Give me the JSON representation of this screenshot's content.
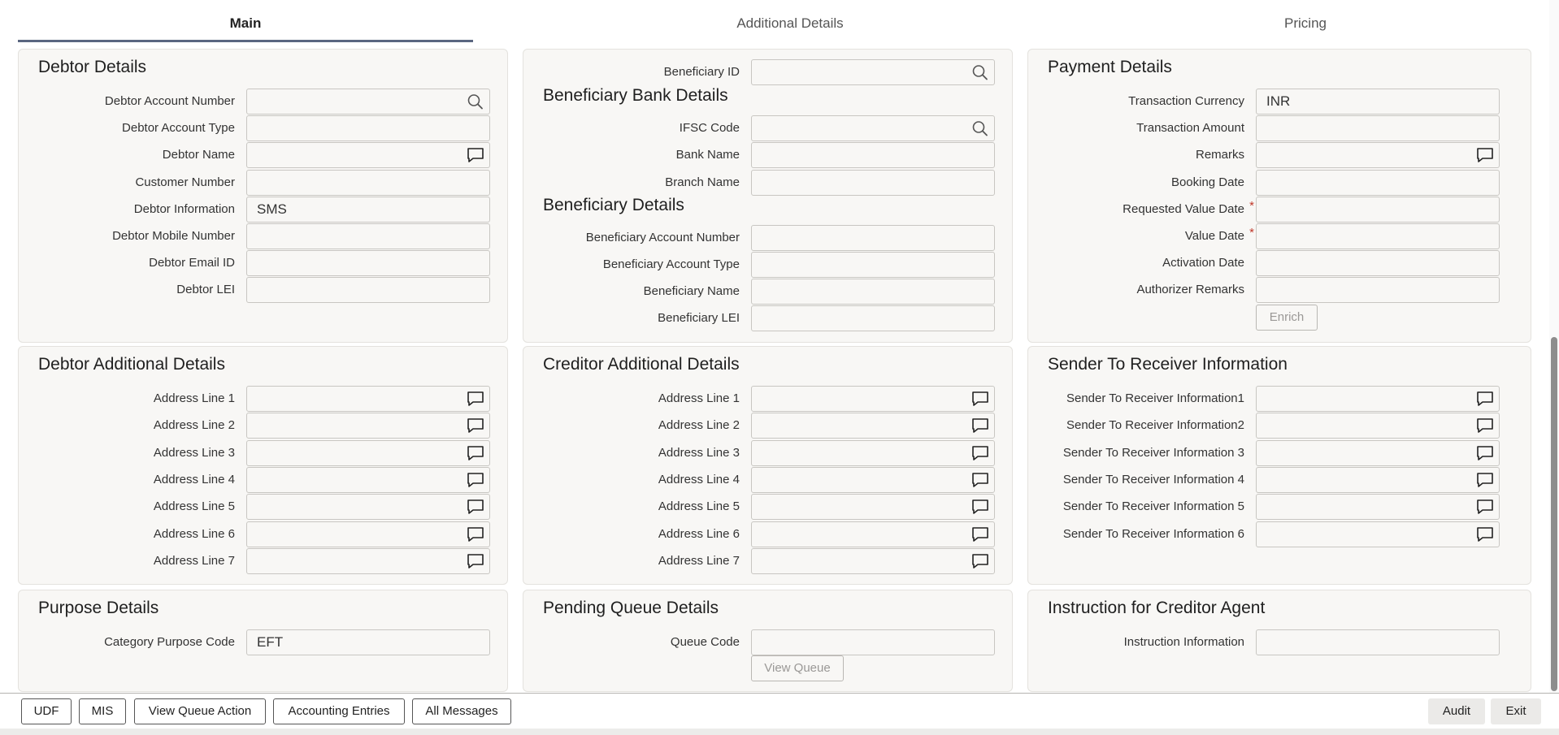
{
  "tabs": [
    {
      "label": "Main",
      "active": true
    },
    {
      "label": "Additional Details",
      "active": false
    },
    {
      "label": "Pricing",
      "active": false
    }
  ],
  "debtor_details": {
    "title": "Debtor Details",
    "fields": [
      {
        "label": "Debtor Account Number",
        "value": "",
        "icon": "search-icon"
      },
      {
        "label": "Debtor Account Type",
        "value": ""
      },
      {
        "label": "Debtor Name",
        "value": "",
        "icon": "comment-icon"
      },
      {
        "label": "Customer Number",
        "value": ""
      },
      {
        "label": "Debtor Information",
        "value": "SMS"
      },
      {
        "label": "Debtor Mobile Number",
        "value": ""
      },
      {
        "label": "Debtor Email ID",
        "value": ""
      },
      {
        "label": "Debtor LEI",
        "value": ""
      }
    ]
  },
  "beneficiary": {
    "id_label": "Beneficiary ID",
    "bank_title": "Beneficiary Bank Details",
    "bank_fields": [
      {
        "label": "IFSC Code",
        "value": "",
        "icon": "search-icon"
      },
      {
        "label": "Bank Name",
        "value": ""
      },
      {
        "label": "Branch Name",
        "value": ""
      }
    ],
    "details_title": "Beneficiary Details",
    "detail_fields": [
      {
        "label": "Beneficiary Account Number",
        "value": ""
      },
      {
        "label": "Beneficiary Account Type",
        "value": ""
      },
      {
        "label": "Beneficiary Name",
        "value": ""
      },
      {
        "label": "Beneficiary LEI",
        "value": ""
      }
    ]
  },
  "payment_details": {
    "title": "Payment Details",
    "fields": [
      {
        "label": "Transaction Currency",
        "value": "INR"
      },
      {
        "label": "Transaction Amount",
        "value": ""
      },
      {
        "label": "Remarks",
        "value": "",
        "icon": "comment-icon"
      },
      {
        "label": "Booking Date",
        "value": ""
      },
      {
        "label": "Requested Value Date",
        "value": "",
        "required": true
      },
      {
        "label": "Value Date",
        "value": "",
        "required": true
      },
      {
        "label": "Activation Date",
        "value": ""
      },
      {
        "label": "Authorizer Remarks",
        "value": ""
      }
    ],
    "enrich_label": "Enrich"
  },
  "debtor_additional": {
    "title": "Debtor Additional Details",
    "fields": [
      "Address Line 1",
      "Address Line 2",
      "Address Line 3",
      "Address Line 4",
      "Address Line 5",
      "Address Line 6",
      "Address Line 7"
    ]
  },
  "creditor_additional": {
    "title": "Creditor Additional Details",
    "fields": [
      "Address Line 1",
      "Address Line 2",
      "Address Line 3",
      "Address Line 4",
      "Address Line 5",
      "Address Line 6",
      "Address Line 7"
    ]
  },
  "sender_receiver": {
    "title": "Sender To Receiver Information",
    "fields": [
      "Sender To Receiver Information1",
      "Sender To Receiver Information2",
      "Sender To Receiver Information 3",
      "Sender To Receiver Information 4",
      "Sender To Receiver Information 5",
      "Sender To Receiver Information 6"
    ]
  },
  "purpose_details": {
    "title": "Purpose Details",
    "label": "Category Purpose Code",
    "value": "EFT"
  },
  "pending_queue": {
    "title": "Pending Queue Details",
    "label": "Queue Code",
    "value": "",
    "button": "View Queue"
  },
  "instruction_creditor": {
    "title": "Instruction for Creditor Agent",
    "label": "Instruction Information",
    "value": ""
  },
  "bottom_buttons": [
    "UDF",
    "MIS",
    "View Queue Action",
    "Accounting Entries",
    "All Messages"
  ],
  "audit_label": "Audit",
  "exit_label": "Exit"
}
